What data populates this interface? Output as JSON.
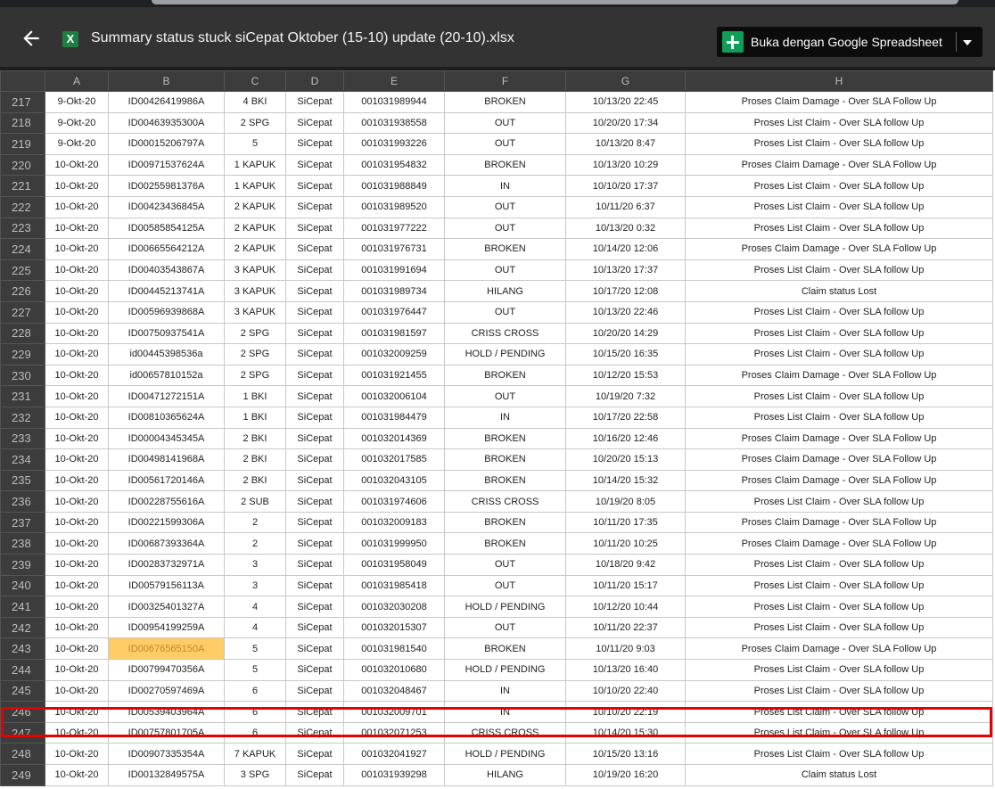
{
  "header": {
    "title": "Summary status stuck siCepat Oktober (15-10) update (20-10).xlsx",
    "file_icon_letter": "X",
    "open_button_label": "Buka dengan Google Spreadsheet"
  },
  "columns": [
    "A",
    "B",
    "C",
    "D",
    "E",
    "F",
    "G",
    "H"
  ],
  "rows": [
    {
      "n": "217",
      "a": "9-Okt-20",
      "b": "ID00426419986A",
      "c": "4 BKI",
      "d": "SiCepat",
      "e": "001031989944",
      "f": "BROKEN",
      "g": "10/13/20 22:45",
      "h": "Proses Claim Damage - Over SLA Follow Up"
    },
    {
      "n": "218",
      "a": "9-Okt-20",
      "b": "ID00463935300A",
      "c": "2 SPG",
      "d": "SiCepat",
      "e": "001031938558",
      "f": "OUT",
      "g": "10/20/20 17:34",
      "h": "Proses List Claim - Over SLA follow Up"
    },
    {
      "n": "219",
      "a": "9-Okt-20",
      "b": "ID00015206797A",
      "c": "5",
      "d": "SiCepat",
      "e": "001031993226",
      "f": "OUT",
      "g": "10/13/20 8:47",
      "h": "Proses List Claim - Over SLA follow Up"
    },
    {
      "n": "220",
      "a": "10-Okt-20",
      "b": "ID00971537624A",
      "c": "1 KAPUK",
      "d": "SiCepat",
      "e": "001031954832",
      "f": "BROKEN",
      "g": "10/13/20 10:29",
      "h": "Proses Claim Damage - Over SLA Follow Up"
    },
    {
      "n": "221",
      "a": "10-Okt-20",
      "b": "ID00255981376A",
      "c": "1 KAPUK",
      "d": "SiCepat",
      "e": "001031988849",
      "f": "IN",
      "g": "10/10/20 17:37",
      "h": "Proses List Claim - Over SLA follow Up"
    },
    {
      "n": "222",
      "a": "10-Okt-20",
      "b": "ID00423436845A",
      "c": "2 KAPUK",
      "d": "SiCepat",
      "e": "001031989520",
      "f": "OUT",
      "g": "10/11/20 6:37",
      "h": "Proses List Claim - Over SLA follow Up"
    },
    {
      "n": "223",
      "a": "10-Okt-20",
      "b": "ID00585854125A",
      "c": "2 KAPUK",
      "d": "SiCepat",
      "e": "001031977222",
      "f": "OUT",
      "g": "10/13/20 0:32",
      "h": "Proses List Claim - Over SLA follow Up"
    },
    {
      "n": "224",
      "a": "10-Okt-20",
      "b": "ID00665564212A",
      "c": "2 KAPUK",
      "d": "SiCepat",
      "e": "001031976731",
      "f": "BROKEN",
      "g": "10/14/20 12:06",
      "h": "Proses Claim Damage - Over SLA Follow Up"
    },
    {
      "n": "225",
      "a": "10-Okt-20",
      "b": "ID00403543867A",
      "c": "3 KAPUK",
      "d": "SiCepat",
      "e": "001031991694",
      "f": "OUT",
      "g": "10/13/20 17:37",
      "h": "Proses List Claim - Over SLA follow Up"
    },
    {
      "n": "226",
      "a": "10-Okt-20",
      "b": "ID00445213741A",
      "c": "3 KAPUK",
      "d": "SiCepat",
      "e": "001031989734",
      "f": "HILANG",
      "g": "10/17/20 12:08",
      "h": "Claim status Lost"
    },
    {
      "n": "227",
      "a": "10-Okt-20",
      "b": "ID00596939868A",
      "c": "3 KAPUK",
      "d": "SiCepat",
      "e": "001031976447",
      "f": "OUT",
      "g": "10/13/20 22:46",
      "h": "Proses List Claim - Over SLA follow Up"
    },
    {
      "n": "228",
      "a": "10-Okt-20",
      "b": "ID00750937541A",
      "c": "2 SPG",
      "d": "SiCepat",
      "e": "001031981597",
      "f": "CRISS CROSS",
      "g": "10/20/20 14:29",
      "h": "Proses List Claim - Over SLA follow Up"
    },
    {
      "n": "229",
      "a": "10-Okt-20",
      "b": "id00445398536a",
      "c": "2 SPG",
      "d": "SiCepat",
      "e": "001032009259",
      "f": "HOLD / PENDING",
      "g": "10/15/20 16:35",
      "h": "Proses List Claim - Over SLA follow Up"
    },
    {
      "n": "230",
      "a": "10-Okt-20",
      "b": "id00657810152a",
      "c": "2 SPG",
      "d": "SiCepat",
      "e": "001031921455",
      "f": "BROKEN",
      "g": "10/12/20 15:53",
      "h": "Proses Claim Damage - Over SLA Follow Up"
    },
    {
      "n": "231",
      "a": "10-Okt-20",
      "b": "ID00471272151A",
      "c": "1 BKI",
      "d": "SiCepat",
      "e": "001032006104",
      "f": "OUT",
      "g": "10/19/20 7:32",
      "h": "Proses List Claim - Over SLA follow Up"
    },
    {
      "n": "232",
      "a": "10-Okt-20",
      "b": "ID00810365624A",
      "c": "1 BKI",
      "d": "SiCepat",
      "e": "001031984479",
      "f": "IN",
      "g": "10/17/20 22:58",
      "h": "Proses List Claim - Over SLA follow Up"
    },
    {
      "n": "233",
      "a": "10-Okt-20",
      "b": "ID00004345345A",
      "c": "2 BKI",
      "d": "SiCepat",
      "e": "001032014369",
      "f": "BROKEN",
      "g": "10/16/20 12:46",
      "h": "Proses Claim Damage - Over SLA Follow Up"
    },
    {
      "n": "234",
      "a": "10-Okt-20",
      "b": "ID00498141968A",
      "c": "2 BKI",
      "d": "SiCepat",
      "e": "001032017585",
      "f": "BROKEN",
      "g": "10/20/20 15:13",
      "h": "Proses Claim Damage - Over SLA Follow Up"
    },
    {
      "n": "235",
      "a": "10-Okt-20",
      "b": "ID00561720146A",
      "c": "2 BKI",
      "d": "SiCepat",
      "e": "001032043105",
      "f": "BROKEN",
      "g": "10/14/20 15:32",
      "h": "Proses Claim Damage - Over SLA Follow Up"
    },
    {
      "n": "236",
      "a": "10-Okt-20",
      "b": "ID00228755616A",
      "c": "2 SUB",
      "d": "SiCepat",
      "e": "001031974606",
      "f": "CRISS CROSS",
      "g": "10/19/20 8:05",
      "h": "Proses List Claim - Over SLA follow Up"
    },
    {
      "n": "237",
      "a": "10-Okt-20",
      "b": "ID00221599306A",
      "c": "2",
      "d": "SiCepat",
      "e": "001032009183",
      "f": "BROKEN",
      "g": "10/11/20 17:35",
      "h": "Proses Claim Damage - Over SLA Follow Up"
    },
    {
      "n": "238",
      "a": "10-Okt-20",
      "b": "ID00687393364A",
      "c": "2",
      "d": "SiCepat",
      "e": "001031999950",
      "f": "BROKEN",
      "g": "10/11/20 10:25",
      "h": "Proses Claim Damage - Over SLA Follow Up"
    },
    {
      "n": "239",
      "a": "10-Okt-20",
      "b": "ID00283732971A",
      "c": "3",
      "d": "SiCepat",
      "e": "001031958049",
      "f": "OUT",
      "g": "10/18/20 9:42",
      "h": "Proses List Claim - Over SLA follow Up"
    },
    {
      "n": "240",
      "a": "10-Okt-20",
      "b": "ID00579156113A",
      "c": "3",
      "d": "SiCepat",
      "e": "001031985418",
      "f": "OUT",
      "g": "10/11/20 15:17",
      "h": "Proses List Claim - Over SLA follow Up"
    },
    {
      "n": "241",
      "a": "10-Okt-20",
      "b": "ID00325401327A",
      "c": "4",
      "d": "SiCepat",
      "e": "001032030208",
      "f": "HOLD / PENDING",
      "g": "10/12/20 10:44",
      "h": "Proses List Claim - Over SLA follow Up"
    },
    {
      "n": "242",
      "a": "10-Okt-20",
      "b": "ID00954199259A",
      "c": "4",
      "d": "SiCepat",
      "e": "001032015307",
      "f": "OUT",
      "g": "10/11/20 22:37",
      "h": "Proses List Claim - Over SLA follow Up"
    },
    {
      "n": "243",
      "a": "10-Okt-20",
      "b": "ID00676565150A",
      "c": "5",
      "d": "SiCepat",
      "e": "001031981540",
      "f": "BROKEN",
      "g": "10/11/20 9:03",
      "h": "Proses Claim Damage - Over SLA Follow Up",
      "highlight": true
    },
    {
      "n": "244",
      "a": "10-Okt-20",
      "b": "ID00799470356A",
      "c": "5",
      "d": "SiCepat",
      "e": "001032010680",
      "f": "HOLD / PENDING",
      "g": "10/13/20 16:40",
      "h": "Proses List Claim - Over SLA follow Up"
    },
    {
      "n": "245",
      "a": "10-Okt-20",
      "b": "ID00270597469A",
      "c": "6",
      "d": "SiCepat",
      "e": "001032048467",
      "f": "IN",
      "g": "10/10/20 22:40",
      "h": "Proses List Claim - Over SLA follow Up"
    },
    {
      "n": "246",
      "a": "10-Okt-20",
      "b": "ID00539403964A",
      "c": "6",
      "d": "SiCepat",
      "e": "001032009701",
      "f": "IN",
      "g": "10/10/20 22:19",
      "h": "Proses List Claim - Over SLA follow Up"
    },
    {
      "n": "247",
      "a": "10-Okt-20",
      "b": "ID00757801705A",
      "c": "6",
      "d": "SiCepat",
      "e": "001032071253",
      "f": "CRISS CROSS",
      "g": "10/14/20 15:30",
      "h": "Proses List Claim - Over SLA follow Up"
    },
    {
      "n": "248",
      "a": "10-Okt-20",
      "b": "ID00907335354A",
      "c": "7 KAPUK",
      "d": "SiCepat",
      "e": "001032041927",
      "f": "HOLD / PENDING",
      "g": "10/15/20 13:16",
      "h": "Proses List Claim - Over SLA follow Up"
    },
    {
      "n": "249",
      "a": "10-Okt-20",
      "b": "ID00132849575A",
      "c": "3 SPG",
      "d": "SiCepat",
      "e": "001031939298",
      "f": "HILANG",
      "g": "10/19/20 16:20",
      "h": "Claim status Lost"
    }
  ],
  "colors": {
    "header_bg": "#333333",
    "highlight_cell": "#ffcc66",
    "selection_border": "#e60000",
    "sheets_green": "#0f9d58"
  }
}
